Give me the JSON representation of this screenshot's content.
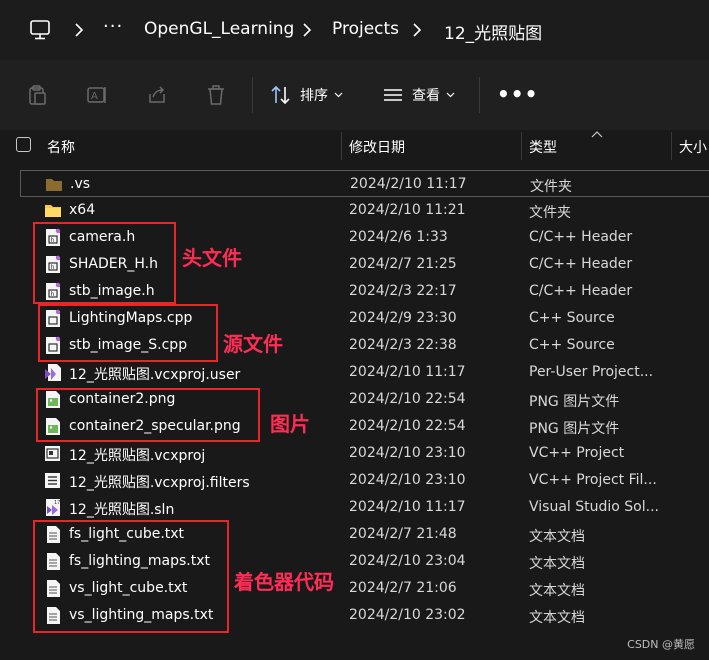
{
  "breadcrumb": {
    "more": "···",
    "items": [
      "OpenGL_Learning",
      "Projects",
      "12_光照贴图"
    ]
  },
  "toolbar": {
    "sort_label": "排序",
    "view_label": "查看",
    "more": "•••"
  },
  "columns": {
    "name": "名称",
    "modified": "修改日期",
    "type": "类型",
    "size": "大小"
  },
  "files": [
    {
      "name": ".vs",
      "date": "2024/2/10 11:17",
      "type": "文件夹",
      "icon": "folder-dark-icon"
    },
    {
      "name": "x64",
      "date": "2024/2/10 11:21",
      "type": "文件夹",
      "icon": "folder-icon"
    },
    {
      "name": "camera.h",
      "date": "2024/2/6 1:33",
      "type": "C/C++ Header",
      "icon": "header-file-icon"
    },
    {
      "name": "SHADER_H.h",
      "date": "2024/2/7 21:25",
      "type": "C/C++ Header",
      "icon": "header-file-icon"
    },
    {
      "name": "stb_image.h",
      "date": "2024/2/3 22:17",
      "type": "C/C++ Header",
      "icon": "header-file-icon"
    },
    {
      "name": "LightingMaps.cpp",
      "date": "2024/2/9 23:30",
      "type": "C++ Source",
      "icon": "cpp-file-icon"
    },
    {
      "name": "stb_image_S.cpp",
      "date": "2024/2/3 22:38",
      "type": "C++ Source",
      "icon": "cpp-file-icon"
    },
    {
      "name": "12_光照贴图.vcxproj.user",
      "date": "2024/2/10 11:17",
      "type": "Per-User Project...",
      "icon": "vs-user-file-icon"
    },
    {
      "name": "container2.png",
      "date": "2024/2/10 22:54",
      "type": "PNG 图片文件",
      "icon": "png-file-icon"
    },
    {
      "name": "container2_specular.png",
      "date": "2024/2/10 22:54",
      "type": "PNG 图片文件",
      "icon": "png-file-icon"
    },
    {
      "name": "12_光照贴图.vcxproj",
      "date": "2024/2/10 23:10",
      "type": "VC++ Project",
      "icon": "vcxproj-file-icon"
    },
    {
      "name": "12_光照贴图.vcxproj.filters",
      "date": "2024/2/10 23:10",
      "type": "VC++ Project Fil...",
      "icon": "filters-file-icon"
    },
    {
      "name": "12_光照贴图.sln",
      "date": "2024/2/10 11:17",
      "type": "Visual Studio Sol...",
      "icon": "sln-file-icon"
    },
    {
      "name": "fs_light_cube.txt",
      "date": "2024/2/7 21:48",
      "type": "文本文档",
      "icon": "text-file-icon"
    },
    {
      "name": "fs_lighting_maps.txt",
      "date": "2024/2/10 23:04",
      "type": "文本文档",
      "icon": "text-file-icon"
    },
    {
      "name": "vs_light_cube.txt",
      "date": "2024/2/7 21:06",
      "type": "文本文档",
      "icon": "text-file-icon"
    },
    {
      "name": "vs_lighting_maps.txt",
      "date": "2024/2/10 23:02",
      "type": "文本文档",
      "icon": "text-file-icon"
    }
  ],
  "annotations": {
    "headers": "头文件",
    "sources": "源文件",
    "images": "图片",
    "shaders": "着色器代码"
  },
  "watermark": "CSDN @黄愿",
  "colors": {
    "background": "#191919",
    "annotation_box": "#e8262a",
    "annotation_text": "#ff2d55",
    "folder": "#f7c948"
  }
}
